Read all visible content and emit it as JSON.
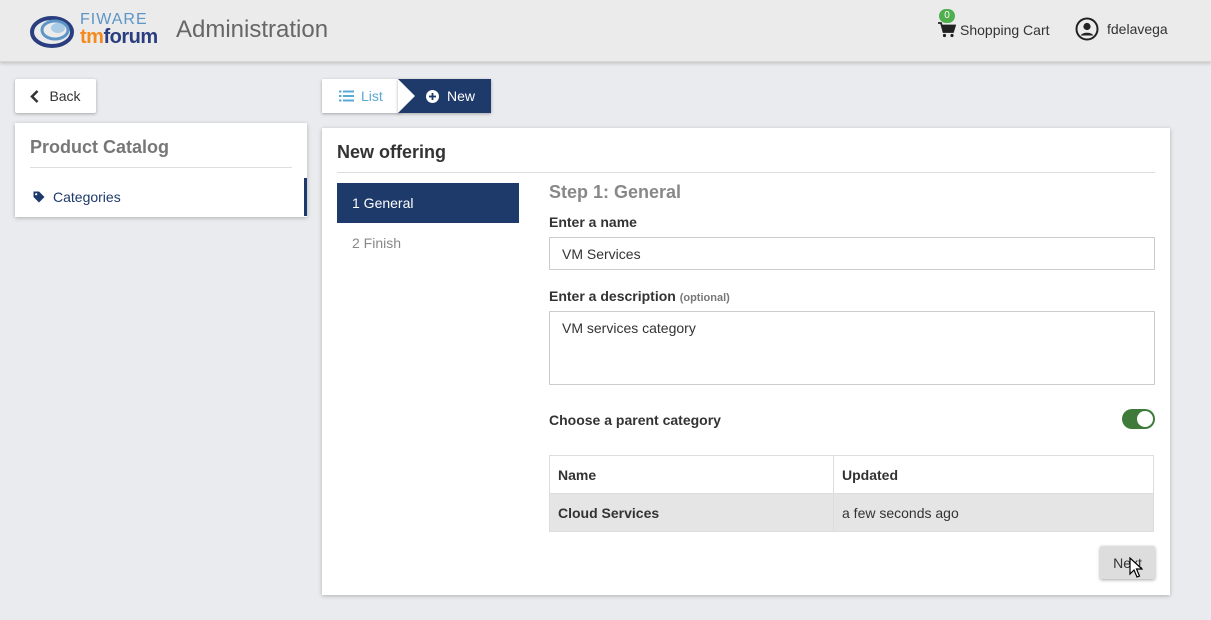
{
  "header": {
    "logo_fiware": "FIWARE",
    "logo_tm": "tm",
    "logo_forum": "forum",
    "title": "Administration",
    "cart_count": "0",
    "cart_label": "Shopping Cart",
    "user_label": "fdelavega"
  },
  "sidebar": {
    "back_label": "Back",
    "card_title": "Product Catalog",
    "items": [
      {
        "label": "Categories",
        "icon": "tag-icon"
      }
    ]
  },
  "tabs": {
    "list_label": "List",
    "new_label": "New"
  },
  "main": {
    "title": "New offering",
    "steps": [
      {
        "label": "1 General",
        "active": true
      },
      {
        "label": "2 Finish",
        "active": false
      }
    ],
    "step_heading": "Step 1: General",
    "name_label": "Enter a name",
    "name_value": "VM Services",
    "description_label": "Enter a description",
    "description_optional": "(optional)",
    "description_value": "VM services category",
    "parent_label": "Choose a parent category",
    "parent_toggle_on": true,
    "table": {
      "headers": [
        "Name",
        "Updated"
      ],
      "rows": [
        {
          "name": "Cloud Services",
          "updated": "a few seconds ago",
          "selected": true
        }
      ]
    },
    "next_label": "Next"
  },
  "colors": {
    "primary": "#1d3a6b",
    "link": "#5aa9d4",
    "toggle_on": "#3e7a3a",
    "badge": "#4fae4e"
  }
}
